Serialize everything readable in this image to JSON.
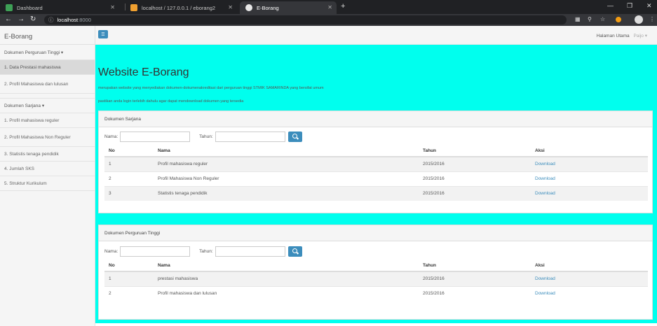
{
  "browser": {
    "tabs": [
      {
        "title": "Dashboard",
        "favicon_color": "#3ea056"
      },
      {
        "title": "localhost / 127.0.0.1 / eborang2",
        "favicon_color": "#f0a030"
      },
      {
        "title": "E-Borang",
        "favicon_color": "#e8e8e8"
      }
    ],
    "url_host": "localhost",
    "url_port": ":8000"
  },
  "sidebar": {
    "brand": "E-Borang",
    "group1_label": "Dokumen Perguruan Tinggi ▾",
    "group1_items": [
      "1. Data Prestasi mahasiswa",
      "2. Profil Mahasiswa dan lulusan"
    ],
    "group2_label": "Dokumen Sarjana ▾",
    "group2_items": [
      "1. Profil mahasiswa reguler",
      "2. Profil Mahasiswa Non Reguler",
      "3. Statistis tenaga pendidik",
      "4. Jumlah SKS",
      "5. Struktur Kurikulum"
    ]
  },
  "topnav": {
    "home": "Halaman Utama",
    "user": "Paijo ▾"
  },
  "hero": {
    "title": "Website E-Borang",
    "desc1": "merupakan website yang menyediakan dokumen-dokumenakreditasi dari perguruan tinggi STMIK SAMARINDA yang bersifat umum",
    "desc2": "pastikan anda login terlebih dahulu agar dapat mendownload dokumen yang tersedia"
  },
  "panel_sarjana": {
    "title": "Dokumen Sarjana",
    "nama_label": "Nama:",
    "tahun_label": "Tahun:",
    "headers": {
      "no": "No",
      "nama": "Nama",
      "tahun": "Tahun",
      "aksi": "Aksi"
    },
    "rows": [
      {
        "no": "1",
        "nama": "Profil mahasiswa reguler",
        "tahun": "2015/2016",
        "aksi": "Download"
      },
      {
        "no": "2",
        "nama": "Profil Mahasiswa Non Reguler",
        "tahun": "2015/2016",
        "aksi": "Download"
      },
      {
        "no": "3",
        "nama": "Statistis tenaga pendidik",
        "tahun": "2015/2016",
        "aksi": "Download"
      }
    ]
  },
  "panel_pt": {
    "title": "Dokumen Perguruan Tinggi",
    "nama_label": "Nama:",
    "tahun_label": "Tahun:",
    "headers": {
      "no": "No",
      "nama": "Nama",
      "tahun": "Tahun",
      "aksi": "Aksi"
    },
    "rows": [
      {
        "no": "1",
        "nama": "prestasi mahasiswa",
        "tahun": "2015/2016",
        "aksi": "Download"
      },
      {
        "no": "2",
        "nama": "Profil mahasiswa dan lulusan",
        "tahun": "2015/2016",
        "aksi": "Download"
      }
    ]
  },
  "colors": {
    "accent": "#3c8dbc",
    "highlight": "#00ffee"
  }
}
